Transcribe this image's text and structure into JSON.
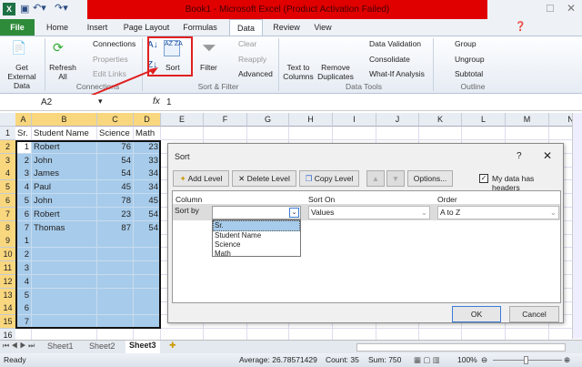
{
  "window": {
    "title": "Book1 - Microsoft Excel (Product Activation Failed)"
  },
  "tabs": [
    {
      "label": "File"
    },
    {
      "label": "Home"
    },
    {
      "label": "Insert"
    },
    {
      "label": "Page Layout"
    },
    {
      "label": "Formulas"
    },
    {
      "label": "Data"
    },
    {
      "label": "Review"
    },
    {
      "label": "View"
    }
  ],
  "ribbon": {
    "get_external": "Get External Data",
    "refresh": "Refresh All",
    "connections": "Connections",
    "properties": "Properties",
    "edit_links": "Edit Links",
    "sort": "Sort",
    "filter": "Filter",
    "clear": "Clear",
    "reapply": "Reapply",
    "advanced": "Advanced",
    "text_to_columns": "Text to Columns",
    "remove_duplicates": "Remove Duplicates",
    "data_validation": "Data Validation",
    "consolidate": "Consolidate",
    "what_if": "What-If Analysis",
    "group": "Group",
    "ungroup": "Ungroup",
    "subtotal": "Subtotal",
    "groups": {
      "connections": "Connections",
      "sort_filter": "Sort & Filter",
      "data_tools": "Data Tools",
      "outline": "Outline"
    }
  },
  "formula_bar": {
    "name_box": "A2",
    "fx": "fx",
    "value": "1"
  },
  "sheet": {
    "columns": [
      "A",
      "B",
      "C",
      "D",
      "E",
      "F",
      "G",
      "H",
      "I",
      "J",
      "K",
      "L",
      "M",
      "N"
    ],
    "rows": [
      [
        "Sr.",
        "Student Name",
        "Science",
        "Math"
      ],
      [
        "1",
        "Robert",
        "76",
        "23"
      ],
      [
        "2",
        "John",
        "54",
        "33"
      ],
      [
        "3",
        "James",
        "54",
        "34"
      ],
      [
        "4",
        "Paul",
        "45",
        "34"
      ],
      [
        "5",
        "John",
        "78",
        "45"
      ],
      [
        "6",
        "Robert",
        "23",
        "54"
      ],
      [
        "7",
        "Thomas",
        "87",
        "54"
      ],
      [
        "1",
        "",
        "",
        ""
      ],
      [
        "2",
        "",
        "",
        ""
      ],
      [
        "3",
        "",
        "",
        ""
      ],
      [
        "4",
        "",
        "",
        ""
      ],
      [
        "5",
        "",
        "",
        ""
      ],
      [
        "6",
        "",
        "",
        ""
      ],
      [
        "7",
        "",
        "",
        ""
      ],
      [
        "",
        "",
        "",
        ""
      ]
    ]
  },
  "dialog": {
    "title": "Sort",
    "help": "?",
    "close": "✕",
    "add_level": "Add Level",
    "delete_level": "Delete Level",
    "copy_level": "Copy Level",
    "options": "Options...",
    "headers_label": "My data has headers",
    "headers_checked": true,
    "col_column": "Column",
    "col_sort_on": "Sort On",
    "col_order": "Order",
    "sort_by": "Sort by",
    "sort_by_value": "",
    "sort_on_value": "Values",
    "order_value": "A to Z",
    "dropdown_options": [
      "Sr.",
      "Student Name",
      "Science",
      "Math"
    ],
    "ok": "OK",
    "cancel": "Cancel"
  },
  "sheet_tabs": [
    "Sheet1",
    "Sheet2",
    "Sheet3"
  ],
  "active_sheet": "Sheet3",
  "status": {
    "ready": "Ready",
    "average": "Average: 26.78571429",
    "count": "Count: 35",
    "sum": "Sum: 750",
    "zoom": "100%"
  }
}
